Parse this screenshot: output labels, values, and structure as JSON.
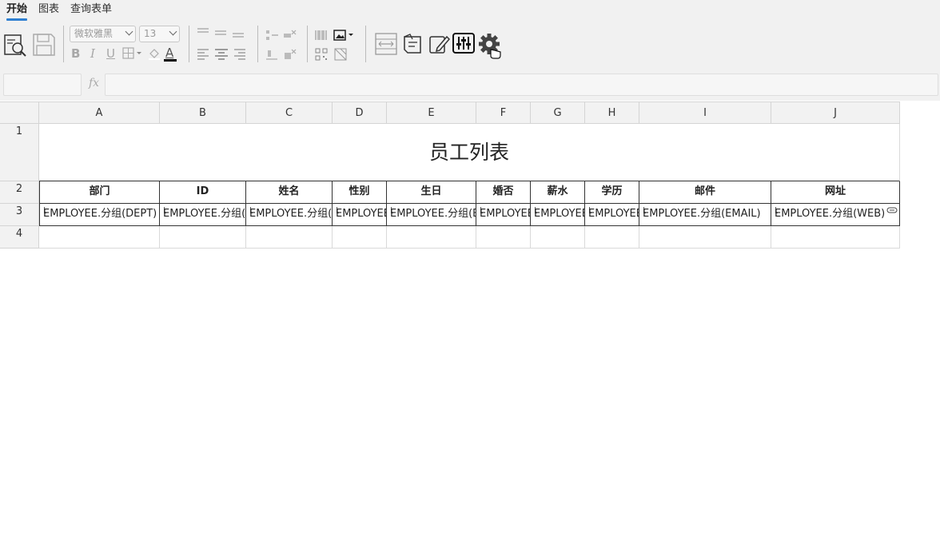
{
  "menu": {
    "tabs": [
      "开始",
      "图表",
      "查询表单"
    ],
    "active": 0
  },
  "toolbar": {
    "font_family": "微软雅黑",
    "font_size": "13",
    "format_bold": "B",
    "format_italic": "I",
    "format_underline": "U",
    "text_color": "A",
    "accent_color": "#2f80d1"
  },
  "formula_bar": {
    "name_box": "",
    "fx_label": "fx",
    "formula": ""
  },
  "sheet": {
    "columns": [
      "A",
      "B",
      "C",
      "D",
      "E",
      "F",
      "G",
      "H",
      "I",
      "J"
    ],
    "rows": [
      "1",
      "2",
      "3",
      "4"
    ],
    "title": "员工列表",
    "headers": [
      "部门",
      "ID",
      "姓名",
      "性别",
      "生日",
      "婚否",
      "薪水",
      "学历",
      "邮件",
      "网址"
    ],
    "data_row": [
      "EMPLOYEE.分组(DEPT)",
      "EMPLOYEE.分组(ID)",
      "EMPLOYEE.分组(NAME)",
      "EMPLOYEE.分组(SEX)",
      "EMPLOYEE.分组(BIRTHDAY)",
      "EMPLOYEE.分组(MARRIED)",
      "EMPLOYEE.分组(SALARY)",
      "EMPLOYEE.分组(DEGREE)",
      "EMPLOYEE.分组(EMAIL)",
      "EMPLOYEE.分组(WEB)"
    ]
  }
}
